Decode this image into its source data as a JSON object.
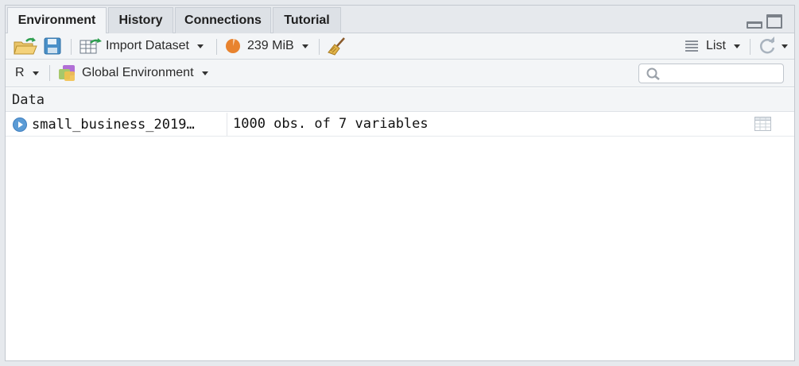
{
  "tabs": [
    {
      "label": "Environment",
      "active": true
    },
    {
      "label": "History",
      "active": false
    },
    {
      "label": "Connections",
      "active": false
    },
    {
      "label": "Tutorial",
      "active": false
    }
  ],
  "toolbar": {
    "import_label": "Import Dataset",
    "memory_label": "239 MiB",
    "view_label": "List"
  },
  "env_bar": {
    "language": "R",
    "environment": "Global Environment",
    "search_placeholder": ""
  },
  "section": {
    "title": "Data"
  },
  "data_rows": [
    {
      "name": "small_business_2019…",
      "value": "1000 obs. of 7 variables"
    }
  ],
  "colors": {
    "accent": "#5b9bd5",
    "memory": "#e8832f",
    "pane_bg": "#f3f5f7"
  }
}
